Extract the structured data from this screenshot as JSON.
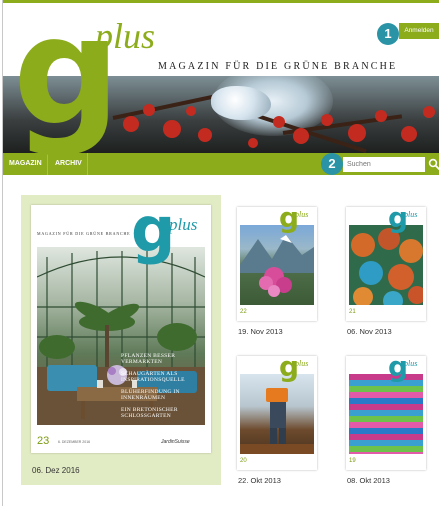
{
  "site": {
    "logo_letter": "g",
    "logo_word": "plus",
    "tagline": "MAGAZIN FÜR DIE GRÜNE BRANCHE",
    "brand_color": "#8cac1c",
    "accent_color": "#2a94a6"
  },
  "header": {
    "login_marker": "1",
    "login_label": "Anmelden"
  },
  "nav": {
    "items": [
      "MAGAZIN",
      "ARCHIV"
    ],
    "search_marker": "2",
    "search_placeholder": "Suchen",
    "search_icon": "search-icon"
  },
  "featured": {
    "date": "06. Dez 2016",
    "cover": {
      "tagline": "MAGAZIN FÜR DIE GRÜNE BRANCHE",
      "logo_letter": "g",
      "logo_word": "plus",
      "headlines": [
        "PFLANZEN BESSER VERMARKTEN",
        "SCHAUGÄRTEN ALS INSPIRATIONSQUELLE",
        "BLÜHERFINDUNG IN INNENRÄUMEN",
        "EIN BRETONISCHER SCHLOSSGARTEN"
      ],
      "issue_number": "23",
      "issue_date": "6. DEZEMBER 2016",
      "brand": "JardinSuisse"
    }
  },
  "issues": [
    {
      "date": "19. Nov 2013",
      "number": "22",
      "logo_color": "#8cac1c"
    },
    {
      "date": "06. Nov 2013",
      "number": "21",
      "logo_color": "#1e9aa8"
    },
    {
      "date": "22. Okt 2013",
      "number": "20",
      "logo_color": "#8cac1c"
    },
    {
      "date": "08. Okt 2013",
      "number": "19",
      "logo_color": "#1e9aa8"
    }
  ]
}
